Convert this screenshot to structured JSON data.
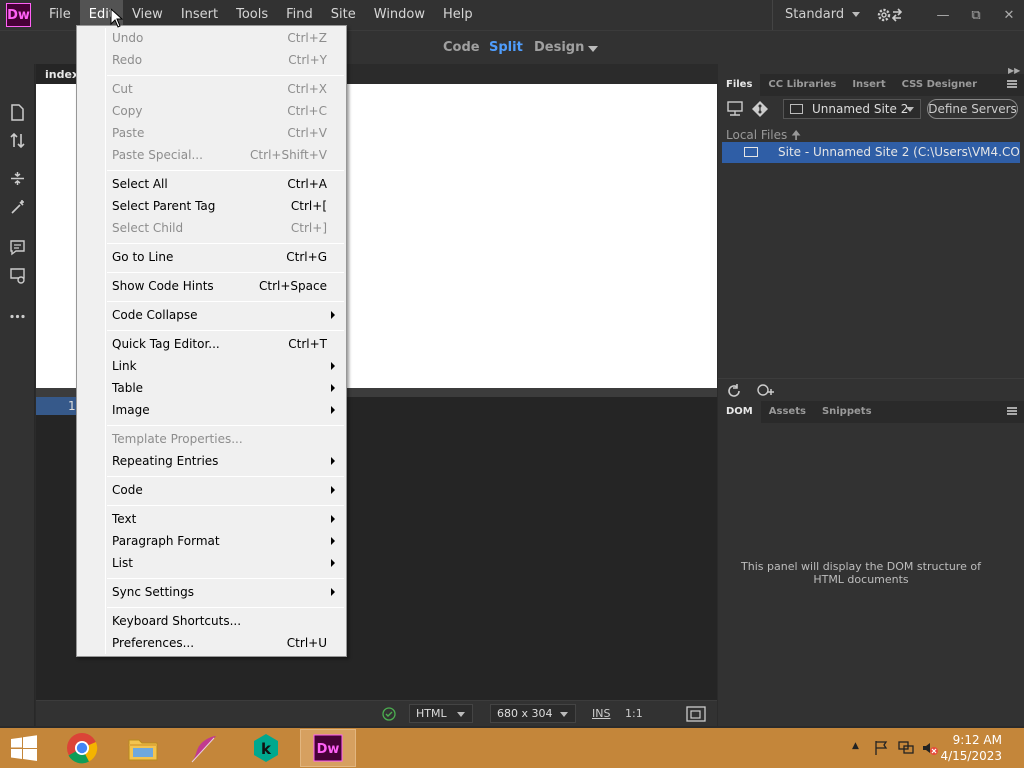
{
  "app": {
    "logo": "Dw",
    "menu": [
      "File",
      "Edit",
      "View",
      "Insert",
      "Tools",
      "Find",
      "Site",
      "Window",
      "Help"
    ],
    "active_menu": "Edit",
    "workspace": "Standard"
  },
  "view_switcher": {
    "code": "Code",
    "split": "Split",
    "design": "Design"
  },
  "document": {
    "tab": "index.",
    "line_number": "1"
  },
  "status_bar": {
    "language": "HTML",
    "window_size": "680 x 304",
    "mode": "INS",
    "position": "1:1"
  },
  "files_panel": {
    "tabs": [
      "Files",
      "CC Libraries",
      "Insert",
      "CSS Designer"
    ],
    "site_name": "Unnamed Site 2",
    "define_servers": "Define Servers",
    "local_files": "Local Files",
    "site_row": "Site - Unnamed Site 2 (C:\\Users\\VM4.COLLABN..."
  },
  "dom_panel": {
    "tabs": [
      "DOM",
      "Assets",
      "Snippets"
    ],
    "empty_message": "This panel will display the DOM structure of HTML documents"
  },
  "edit_menu": [
    {
      "label": "Undo",
      "shortcut": "Ctrl+Z",
      "disabled": true
    },
    {
      "label": "Redo",
      "shortcut": "Ctrl+Y",
      "disabled": true
    },
    {
      "label": "Cut",
      "shortcut": "Ctrl+X",
      "disabled": true
    },
    {
      "label": "Copy",
      "shortcut": "Ctrl+C",
      "disabled": true
    },
    {
      "label": "Paste",
      "shortcut": "Ctrl+V",
      "disabled": true
    },
    {
      "label": "Paste Special...",
      "shortcut": "Ctrl+Shift+V",
      "disabled": true
    },
    {
      "label": "Select All",
      "shortcut": "Ctrl+A"
    },
    {
      "label": "Select Parent Tag",
      "shortcut": "Ctrl+["
    },
    {
      "label": "Select Child",
      "shortcut": "Ctrl+]",
      "disabled": true
    },
    {
      "label": "Go to Line",
      "shortcut": "Ctrl+G"
    },
    {
      "label": "Show Code Hints",
      "shortcut": "Ctrl+Space"
    },
    {
      "label": "Code Collapse",
      "submenu": true
    },
    {
      "label": "Quick Tag Editor...",
      "shortcut": "Ctrl+T"
    },
    {
      "label": "Link",
      "submenu": true
    },
    {
      "label": "Table",
      "submenu": true
    },
    {
      "label": "Image",
      "submenu": true
    },
    {
      "label": "Template Properties...",
      "disabled": true
    },
    {
      "label": "Repeating Entries",
      "submenu": true
    },
    {
      "label": "Code",
      "submenu": true
    },
    {
      "label": "Text",
      "submenu": true
    },
    {
      "label": "Paragraph Format",
      "submenu": true
    },
    {
      "label": "List",
      "submenu": true
    },
    {
      "label": "Sync Settings",
      "submenu": true
    },
    {
      "label": "Keyboard Shortcuts..."
    },
    {
      "label": "Preferences...",
      "shortcut": "Ctrl+U"
    }
  ],
  "taskbar": {
    "clock_time": "9:12 AM",
    "clock_date": "4/15/2023",
    "apps": [
      "start-button",
      "chrome-icon",
      "file-explorer-icon",
      "feather-app-icon",
      "kaspersky-icon",
      "dreamweaver-icon"
    ]
  },
  "colors": {
    "accent_blue": "#4f9dfc",
    "selection_blue": "#2f5ea6",
    "taskbar": "#c4863a",
    "dw_brand": "#ff61f6"
  }
}
